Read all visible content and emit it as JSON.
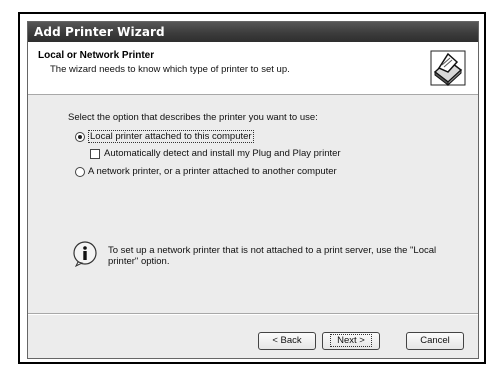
{
  "window": {
    "title": "Add Printer Wizard"
  },
  "header": {
    "title": "Local or Network Printer",
    "subtitle": "The wizard needs to know which type of printer to set up.",
    "icon": "printer-icon"
  },
  "body": {
    "prompt": "Select the option that describes the printer you want to use:",
    "options": [
      {
        "label": "Local printer attached to this computer",
        "type": "radio",
        "selected": true
      },
      {
        "label": "Automatically detect and install my Plug and Play printer",
        "type": "checkbox",
        "checked": false
      },
      {
        "label": "A network printer, or a printer attached to another computer",
        "type": "radio",
        "selected": false
      }
    ],
    "info": {
      "icon": "info-icon",
      "text": "To set up a network printer that is not attached to a print server, use the \"Local printer\" option."
    }
  },
  "buttons": {
    "back": "< Back",
    "next": "Next >",
    "cancel": "Cancel"
  }
}
